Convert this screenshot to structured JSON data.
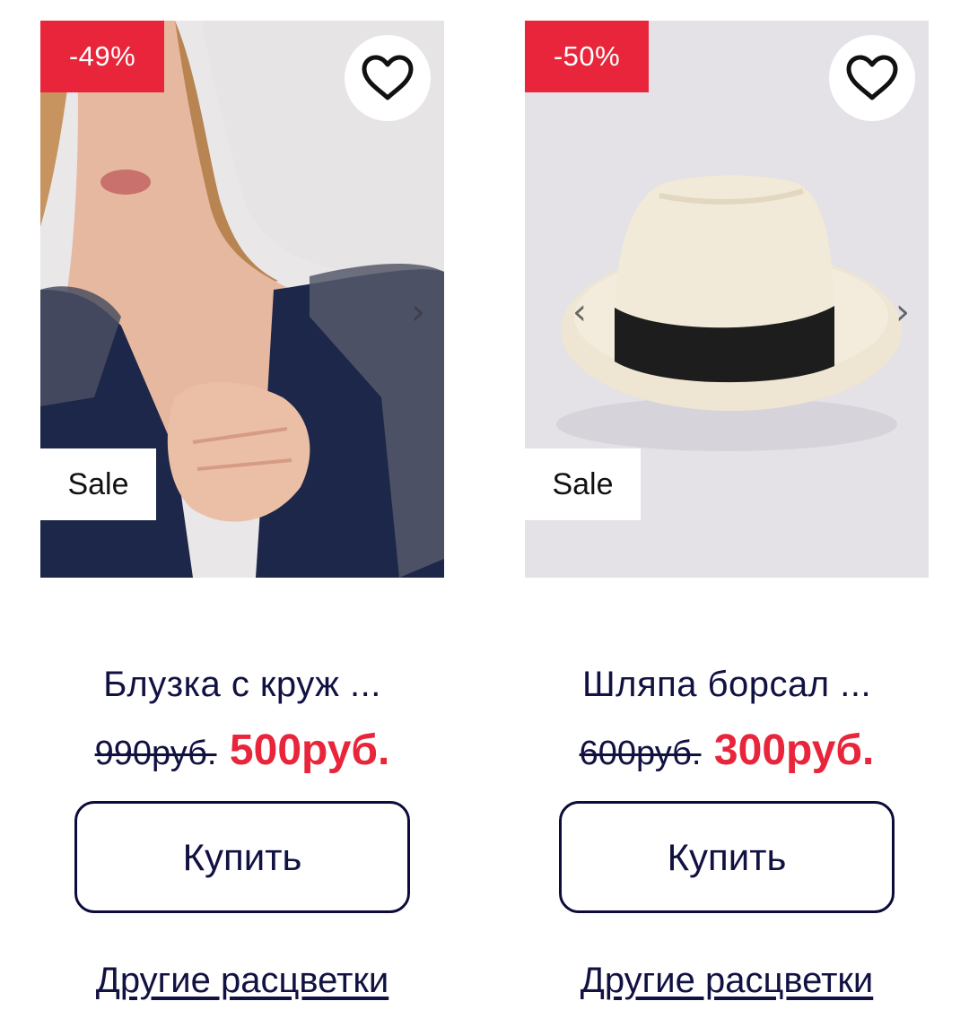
{
  "products": [
    {
      "discount": "-49%",
      "sale_tag": "Sale",
      "title": "Блузка с круж ...",
      "old_price": "990руб.",
      "new_price": "500руб.",
      "buy_label": "Купить",
      "colors_link": "Другие расцветки",
      "icons": {
        "wishlist": "heart-icon",
        "next": "chevron-right-icon"
      }
    },
    {
      "discount": "-50%",
      "sale_tag": "Sale",
      "title": "Шляпа борсал ...",
      "old_price": "600руб.",
      "new_price": "300руб.",
      "buy_label": "Купить",
      "colors_link": "Другие расцветки",
      "icons": {
        "wishlist": "heart-icon",
        "prev": "chevron-left-icon",
        "next": "chevron-right-icon"
      }
    }
  ],
  "colors": {
    "accent_red": "#e8253a",
    "text_navy": "#111142",
    "border_navy": "#0c0c3a"
  }
}
